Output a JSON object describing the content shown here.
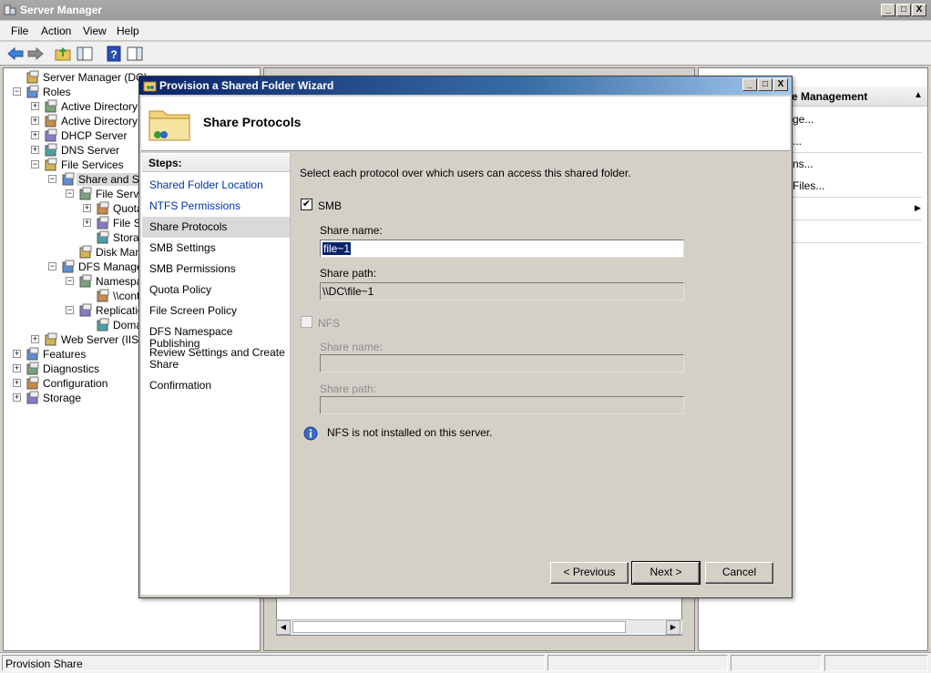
{
  "window": {
    "title": "Server Manager",
    "controls": {
      "minimize": "_",
      "maximize": "□",
      "close": "X"
    }
  },
  "menu": {
    "items": [
      "File",
      "Action",
      "View",
      "Help"
    ]
  },
  "toolbar": {
    "icons": [
      "back-arrow-icon",
      "forward-arrow-icon",
      "up-folder-icon",
      "show-hide-tree-icon",
      "help-icon",
      "properties-icon"
    ]
  },
  "tree": {
    "items": [
      {
        "label": "Server Manager (DC)",
        "icon": "server-manager-icon"
      },
      {
        "label": "Roles",
        "icon": "roles-icon",
        "expander": "−"
      },
      {
        "label": "Active Directory C",
        "icon": "active-directory-icon",
        "expander": "+"
      },
      {
        "label": "Active Directory D",
        "icon": "active-directory-icon",
        "expander": "+"
      },
      {
        "label": "DHCP Server",
        "icon": "dhcp-icon",
        "expander": "+"
      },
      {
        "label": "DNS Server",
        "icon": "dns-icon",
        "expander": "+"
      },
      {
        "label": "File Services",
        "icon": "file-services-icon",
        "expander": "−"
      },
      {
        "label": "Share and Sto",
        "icon": "share-storage-icon",
        "expander": "−"
      },
      {
        "label": "File Serve",
        "icon": "file-server-icon",
        "expander": "−"
      },
      {
        "label": "Quota",
        "icon": "quota-icon",
        "expander": "+"
      },
      {
        "label": "File Sc",
        "icon": "file-screen-icon",
        "expander": "+"
      },
      {
        "label": "Storag",
        "icon": "storage-report-icon"
      },
      {
        "label": "Disk Mana",
        "icon": "disk-management-icon"
      },
      {
        "label": "DFS Managem",
        "icon": "dfs-icon",
        "expander": "−"
      },
      {
        "label": "Namespac",
        "icon": "namespace-icon",
        "expander": "−"
      },
      {
        "label": "\\\\cont",
        "icon": "namespace-root-icon"
      },
      {
        "label": "Replicatio",
        "icon": "replication-icon",
        "expander": "−"
      },
      {
        "label": "Domai",
        "icon": "domain-icon"
      },
      {
        "label": "Web Server (IIS)",
        "icon": "web-server-icon",
        "expander": "+"
      },
      {
        "label": "Features",
        "icon": "features-icon",
        "expander": "+"
      },
      {
        "label": "Diagnostics",
        "icon": "diagnostics-icon",
        "expander": "+"
      },
      {
        "label": "Configuration",
        "icon": "configuration-icon",
        "expander": "+"
      },
      {
        "label": "Storage",
        "icon": "storage-icon",
        "expander": "+"
      }
    ]
  },
  "actions": {
    "header": "e Management",
    "items": [
      "ge...",
      "...",
      "ns...",
      "Files..."
    ],
    "submenu_arrow": "▶",
    "collapse_arrow": "▲"
  },
  "center": {
    "scroll_left": "◀",
    "scroll_right": "▶"
  },
  "status": {
    "text": "Provision Share"
  },
  "wizard": {
    "title": "Provision a Shared Folder Wizard",
    "controls": {
      "minimize": "_",
      "maximize": "□",
      "close": "X"
    },
    "heading": "Share Protocols",
    "steps_title": "Steps:",
    "steps": [
      "Shared Folder Location",
      "NTFS Permissions",
      "Share Protocols",
      "SMB Settings",
      "SMB Permissions",
      "Quota Policy",
      "File Screen Policy",
      "DFS Namespace Publishing",
      "Review Settings and Create Share",
      "Confirmation"
    ],
    "current_step": "Share Protocols",
    "instruction": "Select each protocol over which users can access this shared folder.",
    "smb": {
      "label": "SMB",
      "checked": "✔",
      "share_name_label": "Share name:",
      "share_name_value": "file~1",
      "share_path_label": "Share path:",
      "share_path_value": "\\\\DC\\file~1"
    },
    "nfs": {
      "label": "NFS",
      "share_name_label": "Share name:",
      "share_name_value": "",
      "share_path_label": "Share path:",
      "share_path_value": ""
    },
    "info_text": "NFS is not installed on this server.",
    "buttons": {
      "previous": "< Previous",
      "next": "Next >",
      "cancel": "Cancel"
    }
  }
}
